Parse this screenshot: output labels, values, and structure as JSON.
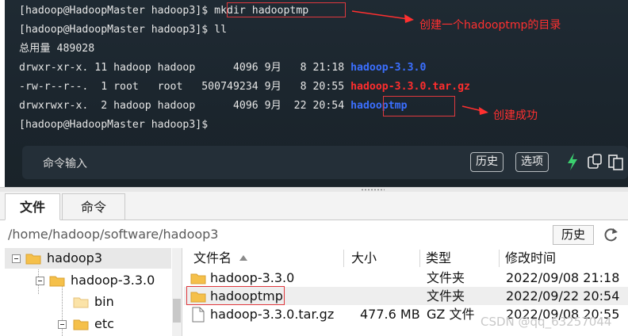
{
  "terminal": {
    "lines": [
      {
        "prompt": "[hadoop@HadoopMaster hadoop3]$ ",
        "command": "mkdir hadooptmp"
      },
      {
        "prompt": "[hadoop@HadoopMaster hadoop3]$ ",
        "command": "ll"
      },
      {
        "text": "总用量 489028"
      },
      {
        "perms": "drwxr-xr-x. 11 hadoop hadoop      4096 9月   8 21:18 ",
        "name": "hadoop-3.3.0",
        "kind": "dir"
      },
      {
        "perms": "-rw-r--r--.  1 root   root   500749234 9月   8 20:55 ",
        "name": "hadoop-3.3.0.tar.gz",
        "kind": "archive"
      },
      {
        "perms": "drwxrwxr-x.  2 hadoop hadoop      4096 9月  22 20:54 ",
        "name": "hadooptmp",
        "kind": "dir"
      },
      {
        "prompt": "[hadoop@HadoopMaster hadoop3]$",
        "command": ""
      }
    ],
    "annotations": {
      "create_dir": "创建一个hadooptmp的目录",
      "created_ok": "创建成功"
    },
    "cmd_bar": {
      "label": "命令输入",
      "history": "历史",
      "options": "选项"
    },
    "colors": {
      "dir": "#3b6fff",
      "archive": "#ff2d2d",
      "annotation": "#ff3030",
      "bolt": "#3bd16f"
    }
  },
  "files": {
    "tabs": [
      "文件",
      "命令"
    ],
    "path": "/home/hadoop/software/hadoop3",
    "history_button": "历史",
    "tree": [
      {
        "label": "hadoop3"
      },
      {
        "label": "hadoop-3.3.0"
      },
      {
        "label": "bin"
      },
      {
        "label": "etc"
      }
    ],
    "columns": [
      "文件名",
      "大小",
      "类型",
      "修改时间"
    ],
    "rows": [
      {
        "name": "hadoop-3.3.0",
        "size": "",
        "type": "文件夹",
        "modified": "2022/09/08 21:18",
        "icon": "folder-icon"
      },
      {
        "name": "hadooptmp",
        "size": "",
        "type": "文件夹",
        "modified": "2022/09/22 20:54",
        "icon": "folder-icon"
      },
      {
        "name": "hadoop-3.3.0.tar.gz",
        "size": "477.6 MB",
        "type": "GZ 文件",
        "modified": "2022/09/08 20:55",
        "icon": "file-icon"
      }
    ]
  },
  "watermark": "CSDN @qq_63257044"
}
